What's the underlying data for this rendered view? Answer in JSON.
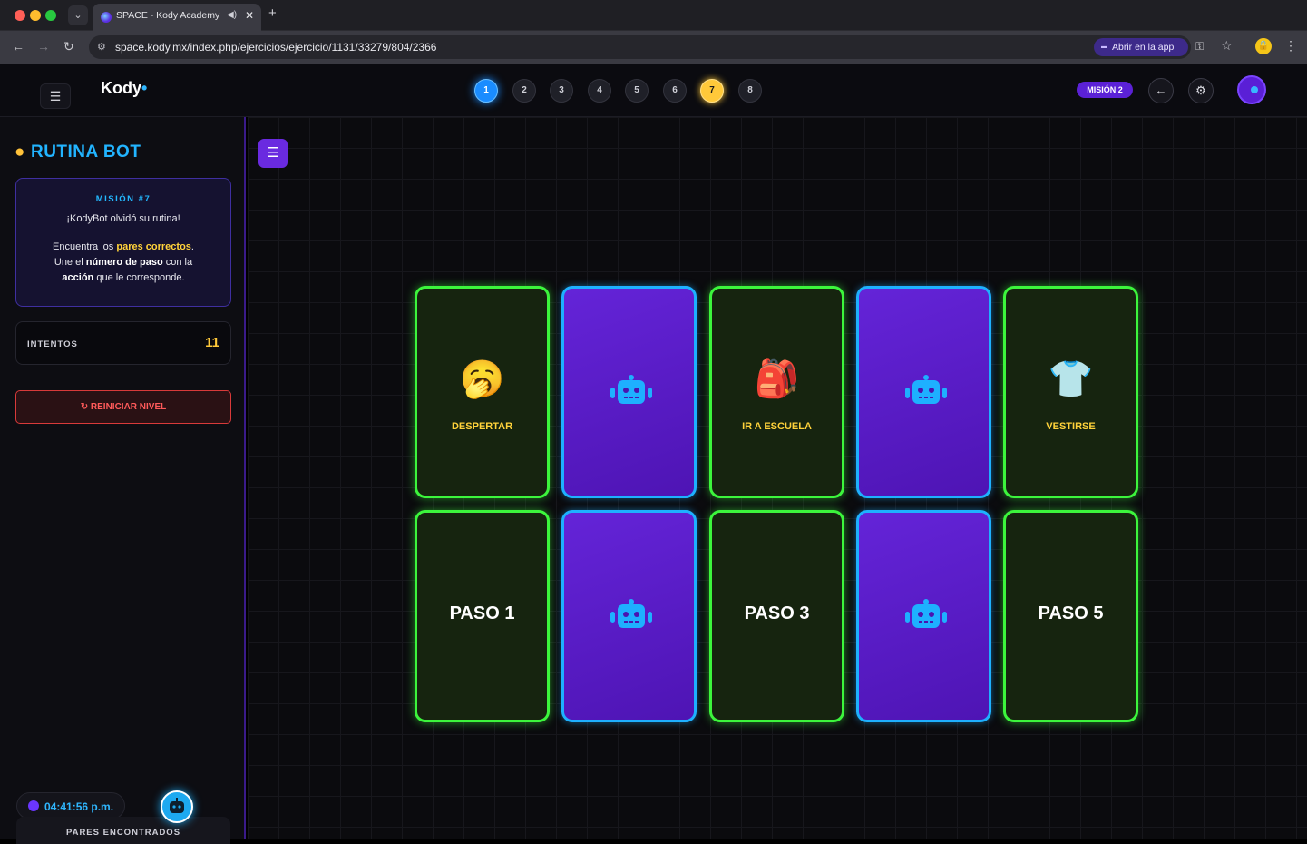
{
  "browser": {
    "tab_title": "SPACE - Kody Academy",
    "url": "space.kody.mx/index.php/ejercicios/ejercicio/1131/33279/804/2366",
    "open_app_label": "Abrir en la app"
  },
  "header": {
    "logo_text": "Kody",
    "steps": [
      "1",
      "2",
      "3",
      "4",
      "5",
      "6",
      "7",
      "8"
    ],
    "mission_badge": "MISIÓN 2"
  },
  "sidebar": {
    "title": "RUTINA BOT",
    "mission_label": "MISIÓN #7",
    "mission_heading": "¡KodyBot olvidó su rutina!",
    "desc_1": "Encuentra los ",
    "desc_2": "pares correctos",
    "desc_3": ".",
    "desc_4": "Une el ",
    "desc_5": "número de paso",
    "desc_6": " con la",
    "desc_7": "acción",
    "desc_8": " que le corresponde.",
    "attempts_label": "INTENTOS",
    "attempts_value": "11",
    "reset_label": "REINICIAR NIVEL",
    "time": "04:41:56 p.m.",
    "pairs_label": "PARES ENCONTRADOS"
  },
  "board": {
    "cards": [
      {
        "state": "revealed",
        "emoji": "🥱",
        "label": "DESPERTAR"
      },
      {
        "state": "hidden"
      },
      {
        "state": "revealed",
        "emoji": "🎒",
        "label": "IR A ESCUELA"
      },
      {
        "state": "hidden"
      },
      {
        "state": "revealed",
        "emoji": "👕",
        "label": "VESTIRSE"
      },
      {
        "state": "revealed",
        "step": "PASO 1"
      },
      {
        "state": "hidden"
      },
      {
        "state": "revealed",
        "step": "PASO 3"
      },
      {
        "state": "hidden"
      },
      {
        "state": "revealed",
        "step": "PASO 5"
      }
    ]
  },
  "colors": {
    "accent_blue": "#22b4ff",
    "accent_purple": "#6a2ae0",
    "matched_green": "#3cf53c",
    "highlight_yellow": "#ffd23a",
    "danger_red": "#ff5a5a"
  }
}
